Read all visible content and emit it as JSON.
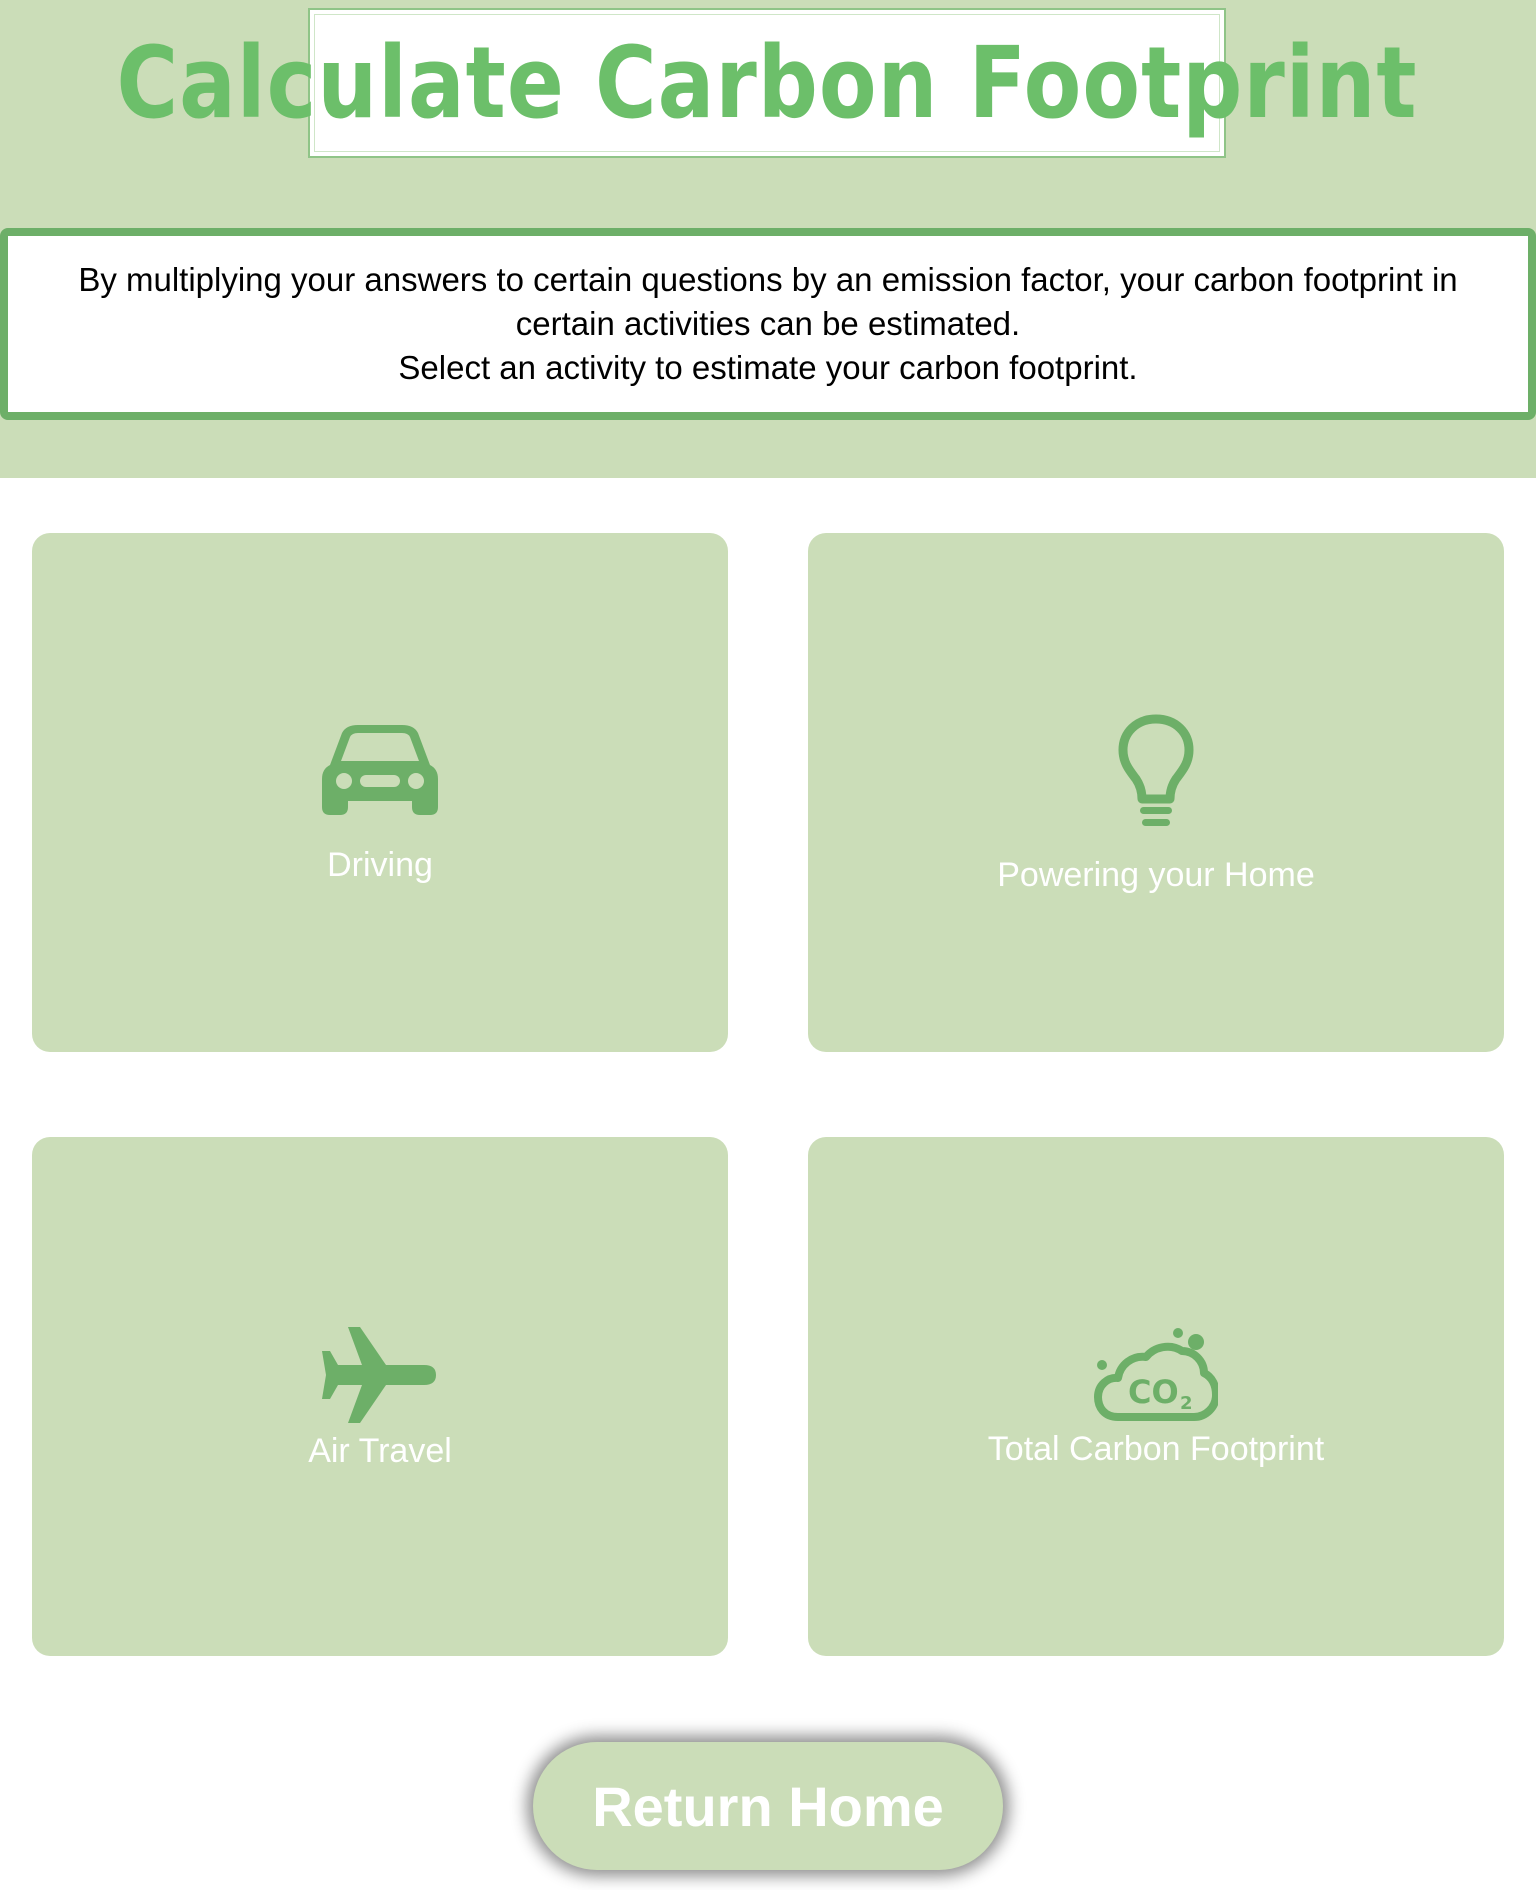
{
  "header": {
    "title": "Calculate Carbon Footprint",
    "description_line1": "By multiplying your answers to certain questions by an emission factor, your carbon footprint in certain activities can be estimated.",
    "description_line2": "Select an activity to estimate your carbon footprint."
  },
  "activities": [
    {
      "label": "Driving",
      "icon": "car-icon"
    },
    {
      "label": "Powering your Home",
      "icon": "lightbulb-icon"
    },
    {
      "label": "Air Travel",
      "icon": "airplane-icon"
    },
    {
      "label": "Total Carbon Footprint",
      "icon": "co2-cloud-icon"
    }
  ],
  "footer": {
    "return_label": "Return Home"
  },
  "colors": {
    "panel_green": "#cbddb8",
    "accent_green": "#6daf68",
    "title_green": "#6cbf6a",
    "label_white": "#ffffff"
  }
}
